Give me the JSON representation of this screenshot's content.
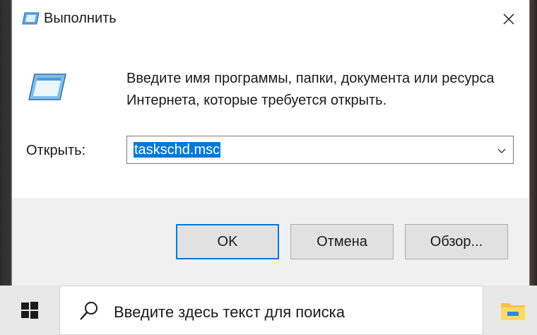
{
  "dialog": {
    "title": "Выполнить",
    "description": "Введите имя программы, папки, документа или ресурса Интернета, которые требуется открыть.",
    "open_label": "Открыть:",
    "open_value": "taskschd.msc",
    "buttons": {
      "ok": "OK",
      "cancel": "Отмена",
      "browse": "Обзор..."
    }
  },
  "taskbar": {
    "search_placeholder": "Введите здесь текст для поиска"
  },
  "colors": {
    "accent": "#0078d7",
    "footer_bg": "#f0f0f0",
    "button_bg": "#e1e1e1"
  },
  "icons": [
    "run-icon",
    "close-icon",
    "chevron-down-icon",
    "windows-logo-icon",
    "search-icon",
    "file-explorer-icon"
  ]
}
